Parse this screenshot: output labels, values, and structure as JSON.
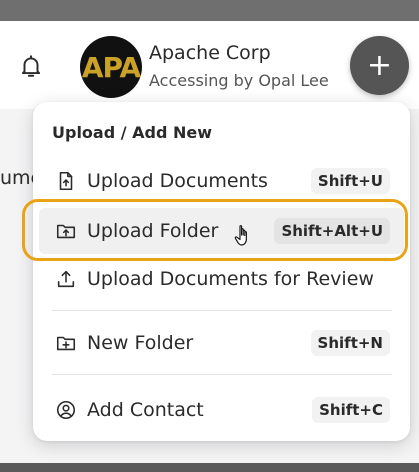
{
  "header": {
    "account_name": "Apache Corp",
    "account_subtitle": "Accessing by Opal Lee",
    "logo_text": "APA",
    "logo_color": "#c9a227",
    "fab_label": "+",
    "bell_icon": "bell-icon"
  },
  "background": {
    "fragment_text": "ume"
  },
  "menu": {
    "title": "Upload / Add New",
    "items": [
      {
        "label": "Upload Documents",
        "shortcut": "Shift+U",
        "icon": "file-upload-icon"
      },
      {
        "label": "Upload Folder",
        "shortcut": "Shift+Alt+U",
        "icon": "folder-upload-icon",
        "hovered": true
      },
      {
        "label": "Upload Documents for Review",
        "shortcut": "",
        "icon": "upload-icon"
      },
      {
        "label": "New Folder",
        "shortcut": "Shift+N",
        "icon": "folder-plus-icon"
      },
      {
        "label": "Add Contact",
        "shortcut": "Shift+C",
        "icon": "user-circle-icon"
      }
    ]
  },
  "colors": {
    "highlight": "#e8a317",
    "fab": "#555556"
  }
}
